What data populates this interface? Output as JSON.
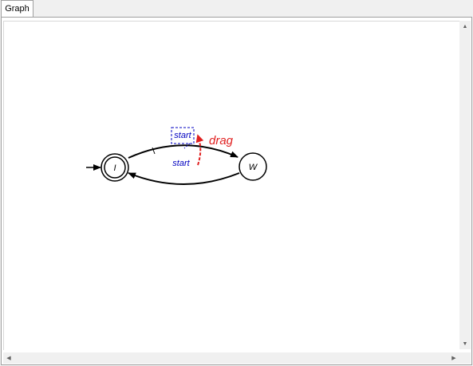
{
  "tabs": [
    {
      "label": "Graph"
    }
  ],
  "graph": {
    "states": [
      {
        "label": "I",
        "initial": true,
        "accepting": true
      },
      {
        "label": "W",
        "initial": false,
        "accepting": false
      }
    ],
    "transitions": [
      {
        "from": "I",
        "to": "W",
        "label": "start",
        "selected": true
      },
      {
        "from": "W",
        "to": "I",
        "label": "start",
        "selected": false
      }
    ],
    "annotation": {
      "text": "drag",
      "color": "#e02020"
    },
    "colors": {
      "edge": "#000000",
      "label": "#0000c0",
      "selection": "#0000c0"
    }
  },
  "icons": {
    "scroll_up": "triangle-up-icon",
    "scroll_down": "triangle-down-icon",
    "scroll_left": "triangle-left-icon",
    "scroll_right": "triangle-right-icon"
  }
}
